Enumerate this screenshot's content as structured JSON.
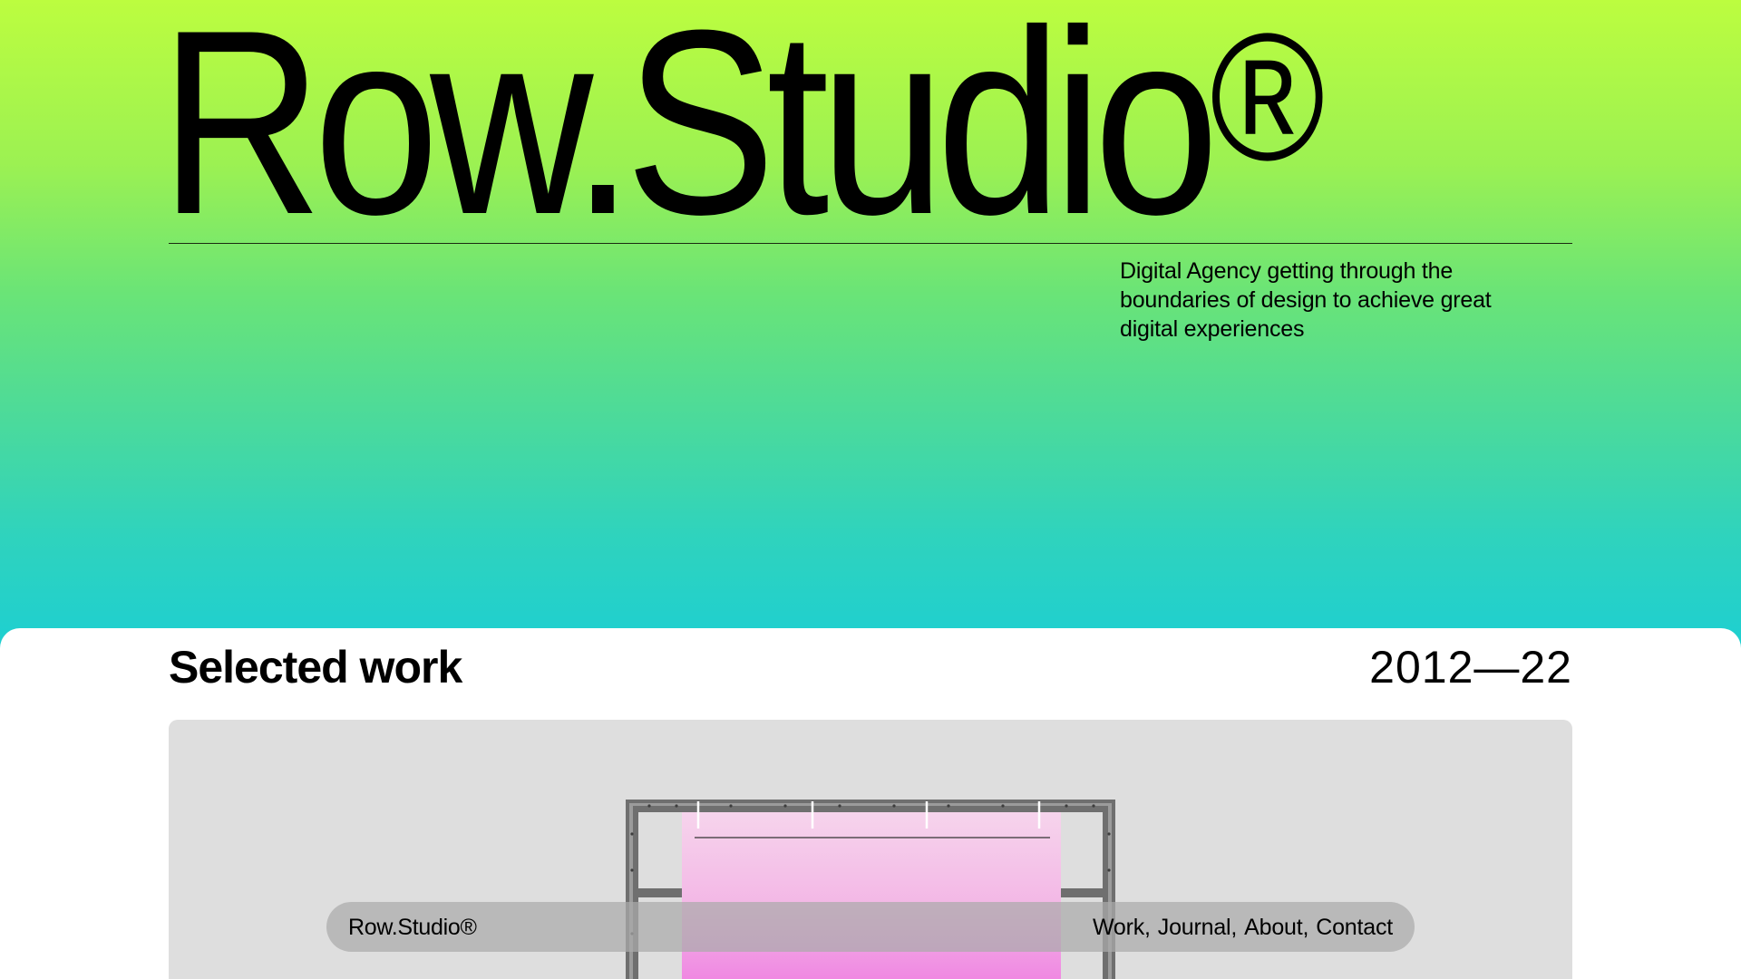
{
  "hero": {
    "title": "Row.Studio",
    "title_mark": "®",
    "tagline": "Digital Agency getting through the boundaries of design to achieve great digital experiences"
  },
  "work": {
    "title": "Selected work",
    "years": "2012—22"
  },
  "nav": {
    "brand": "Row.Studio®",
    "links": [
      "Work",
      "Journal",
      "About",
      "Contact"
    ],
    "separator": ","
  },
  "colors": {
    "gradient_top": "#bcfd3f",
    "gradient_bottom": "#1dcfd2",
    "card_bg": "#dedede",
    "panel_pink_top": "#f6d4ec",
    "panel_pink_bottom": "#ee78de"
  }
}
